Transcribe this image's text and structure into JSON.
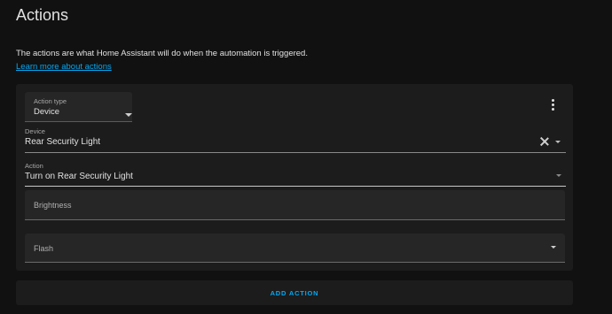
{
  "section": {
    "title": "Actions",
    "description": "The actions are what Home Assistant will do when the automation is triggered.",
    "learn_more": "Learn more about actions"
  },
  "action_card": {
    "action_type": {
      "label": "Action type",
      "value": "Device"
    },
    "device": {
      "label": "Device",
      "value": "Rear Security Light"
    },
    "action": {
      "label": "Action",
      "value": "Turn on Rear Security Light"
    },
    "brightness": {
      "label": "Brightness"
    },
    "flash": {
      "label": "Flash"
    }
  },
  "add_action": {
    "label": "ADD ACTION"
  },
  "colors": {
    "accent": "#03a9f4",
    "background": "#111111",
    "card": "#1c1c1c"
  },
  "icons": [
    "chevron-down-icon",
    "more-vertical-icon",
    "close-icon"
  ]
}
